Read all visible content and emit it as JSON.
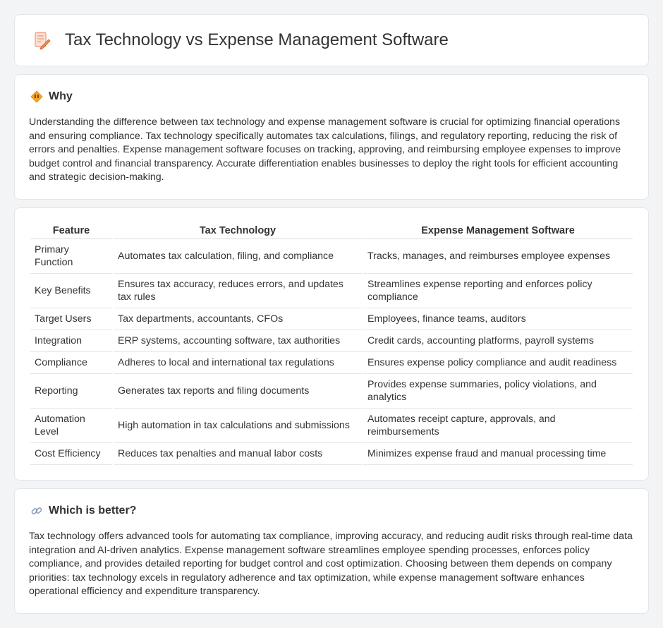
{
  "header": {
    "title": "Tax Technology vs Expense Management Software",
    "icon": "document-pencil-icon"
  },
  "why": {
    "heading": "Why",
    "icon": "diamond-warning-icon",
    "text": "Understanding the difference between tax technology and expense management software is crucial for optimizing financial operations and ensuring compliance. Tax technology specifically automates tax calculations, filings, and regulatory reporting, reducing the risk of errors and penalties. Expense management software focuses on tracking, approving, and reimbursing employee expenses to improve budget control and financial transparency. Accurate differentiation enables businesses to deploy the right tools for efficient accounting and strategic decision-making."
  },
  "table": {
    "columns": [
      "Feature",
      "Tax Technology",
      "Expense Management Software"
    ],
    "rows": [
      [
        "Primary Function",
        "Automates tax calculation, filing, and compliance",
        "Tracks, manages, and reimburses employee expenses"
      ],
      [
        "Key Benefits",
        "Ensures tax accuracy, reduces errors, and updates tax rules",
        "Streamlines expense reporting and enforces policy compliance"
      ],
      [
        "Target Users",
        "Tax departments, accountants, CFOs",
        "Employees, finance teams, auditors"
      ],
      [
        "Integration",
        "ERP systems, accounting software, tax authorities",
        "Credit cards, accounting platforms, payroll systems"
      ],
      [
        "Compliance",
        "Adheres to local and international tax regulations",
        "Ensures expense policy compliance and audit readiness"
      ],
      [
        "Reporting",
        "Generates tax reports and filing documents",
        "Provides expense summaries, policy violations, and analytics"
      ],
      [
        "Automation Level",
        "High automation in tax calculations and submissions",
        "Automates receipt capture, approvals, and reimbursements"
      ],
      [
        "Cost Efficiency",
        "Reduces tax penalties and manual labor costs",
        "Minimizes expense fraud and manual processing time"
      ]
    ]
  },
  "better": {
    "heading": "Which is better?",
    "icon": "link-icon",
    "text": "Tax technology offers advanced tools for automating tax compliance, improving accuracy, and reducing audit risks through real-time data integration and AI-driven analytics. Expense management software streamlines employee spending processes, enforces policy compliance, and provides detailed reporting for budget control and cost optimization. Choosing between them depends on company priorities: tax technology excels in regulatory adherence and tax optimization, while expense management software enhances operational efficiency and expenditure transparency."
  }
}
